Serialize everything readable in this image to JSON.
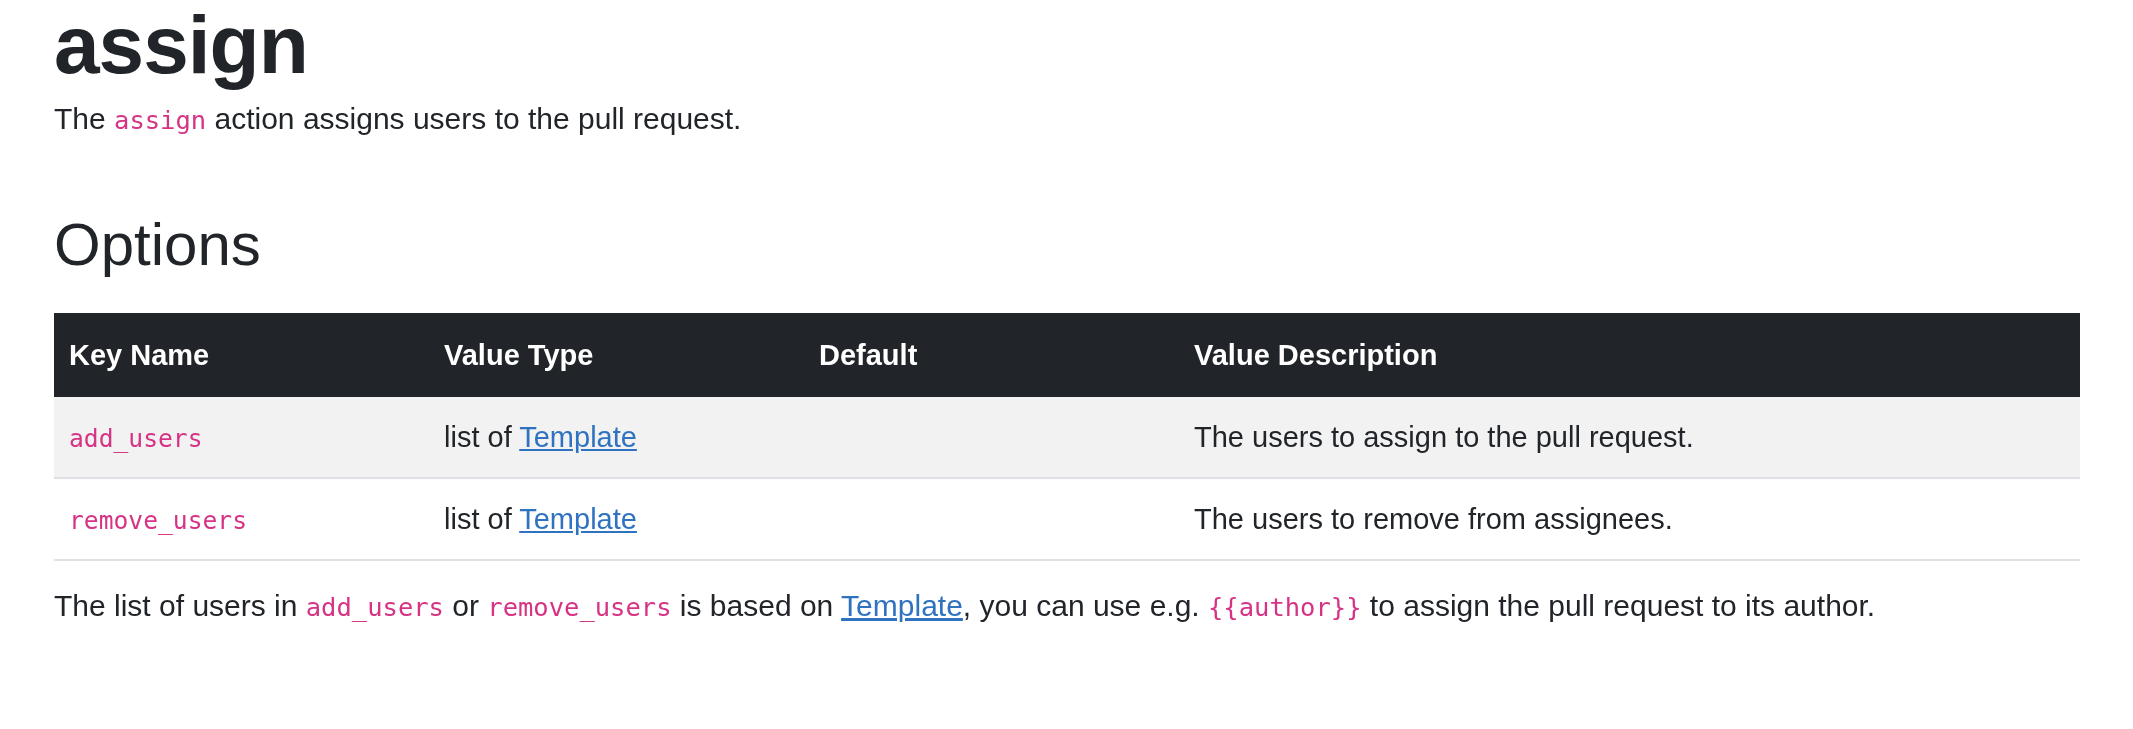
{
  "title": "assign",
  "intro": [
    {
      "kind": "text",
      "text": "The "
    },
    {
      "kind": "code",
      "text": "assign"
    },
    {
      "kind": "text",
      "text": " action assigns users to the pull request."
    }
  ],
  "section_heading": "Options",
  "table": {
    "columns": [
      "Key Name",
      "Value Type",
      "Default",
      "Value Description"
    ],
    "rows": [
      {
        "key": "add_users",
        "value_type": [
          {
            "kind": "text",
            "text": "list of "
          },
          {
            "kind": "link",
            "text": "Template"
          }
        ],
        "description": "The users to assign to the pull request."
      },
      {
        "key": "remove_users",
        "value_type": [
          {
            "kind": "text",
            "text": "list of "
          },
          {
            "kind": "link",
            "text": "Template"
          }
        ],
        "description": "The users to remove from assignees."
      }
    ]
  },
  "note": [
    {
      "kind": "text",
      "text": "The list of users in "
    },
    {
      "kind": "code",
      "text": "add_users"
    },
    {
      "kind": "text",
      "text": " or "
    },
    {
      "kind": "code",
      "text": "remove_users"
    },
    {
      "kind": "text",
      "text": " is based on "
    },
    {
      "kind": "link",
      "text": "Template"
    },
    {
      "kind": "text",
      "text": ", you can use e.g. "
    },
    {
      "kind": "code",
      "text": "{{author}}"
    },
    {
      "kind": "text",
      "text": " to assign the pull request to its author."
    }
  ]
}
